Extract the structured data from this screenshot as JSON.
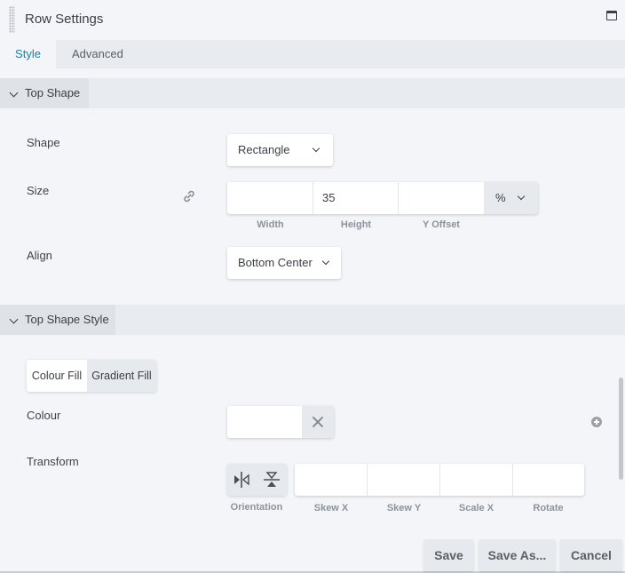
{
  "window": {
    "title": "Row Settings",
    "maximize_icon": "window-maximize-icon"
  },
  "tabs": [
    {
      "label": "Style",
      "active": true
    },
    {
      "label": "Advanced",
      "active": false
    }
  ],
  "top_shape": {
    "section_title": "Top Shape",
    "shape": {
      "label": "Shape",
      "value": "Rectangle"
    },
    "size": {
      "label": "Size",
      "width": "",
      "height": "35",
      "y_offset": "",
      "unit": "%",
      "width_label": "Width",
      "height_label": "Height",
      "y_offset_label": "Y Offset"
    },
    "align": {
      "label": "Align",
      "value": "Bottom Center"
    }
  },
  "top_shape_style": {
    "section_title": "Top Shape Style",
    "fill_toggle": {
      "colour_fill": "Colour Fill",
      "gradient_fill": "Gradient Fill",
      "selected": "Colour Fill"
    },
    "colour": {
      "label": "Colour",
      "value": ""
    },
    "transform": {
      "label": "Transform",
      "orientation_label": "Orientation",
      "skew_x_label": "Skew X",
      "skew_y_label": "Skew Y",
      "scale_x_label": "Scale X",
      "rotate_label": "Rotate",
      "skew_x": "",
      "skew_y": "",
      "scale_x": "",
      "rotate": ""
    }
  },
  "footer": {
    "save": "Save",
    "save_as": "Save As...",
    "cancel": "Cancel"
  },
  "colors": {
    "accent": "#1f7fa0",
    "panel_bg": "#f3f5f8",
    "section_bg": "#e8ebef"
  }
}
